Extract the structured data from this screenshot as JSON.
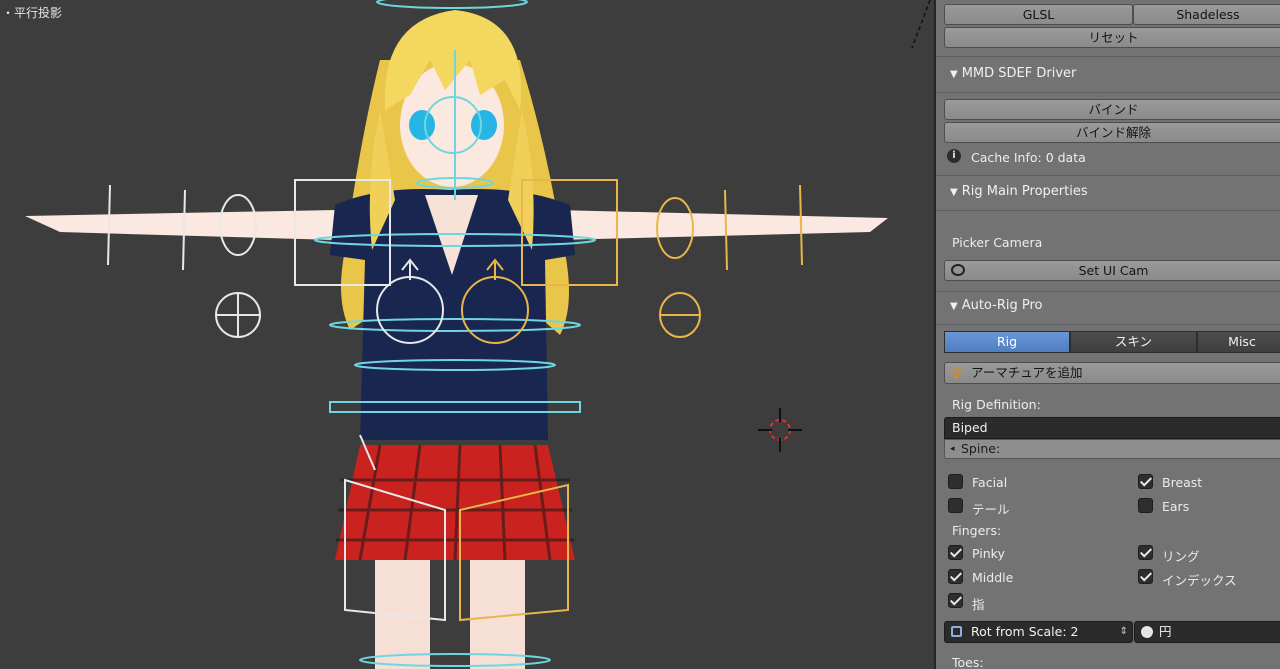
{
  "viewport": {
    "label": "・平行投影"
  },
  "panel": {
    "shading": {
      "glsl_label": "GLSL",
      "shadeless_label": "Shadeless",
      "reset_label": "リセット"
    },
    "mmd_sdef": {
      "title": "MMD SDEF Driver",
      "bind_label": "バインド",
      "unbind_label": "バインド解除",
      "cache_info": "Cache Info: 0 data"
    },
    "rig_main": {
      "title": "Rig Main Properties",
      "picker_camera_label": "Picker Camera",
      "set_ui_cam_label": "Set UI Cam"
    },
    "auto_rig": {
      "title": "Auto-Rig Pro",
      "tabs": [
        {
          "label": "Rig",
          "active": true
        },
        {
          "label": "スキン",
          "active": false
        },
        {
          "label": "Misc",
          "active": false
        }
      ],
      "add_armature_label": "アーマチュアを追加",
      "rig_definition_label": "Rig Definition:",
      "rig_definition_value": "Biped",
      "spine_label": "Spine:",
      "options": [
        {
          "label": "Facial",
          "checked": false
        },
        {
          "label": "Breast",
          "checked": true
        },
        {
          "label": "テール",
          "checked": false
        },
        {
          "label": "Ears",
          "checked": false
        }
      ],
      "fingers_label": "Fingers:",
      "fingers": [
        {
          "label": "Pinky",
          "checked": true
        },
        {
          "label": "リング",
          "checked": true
        },
        {
          "label": "Middle",
          "checked": true
        },
        {
          "label": "インデックス",
          "checked": true
        },
        {
          "label": "指",
          "checked": true
        }
      ],
      "rot_from_scale_label": "Rot from Scale: 2",
      "circle_label": "円",
      "toes_label": "Toes:"
    }
  },
  "colors": {
    "viewport_bg": "#3d3d3d",
    "panel_bg": "#737373",
    "active_tab": "#5a8ad0",
    "bone_cyan": "#6fd6e0",
    "bone_yellow": "#e8b64a",
    "bone_white": "#e8e8e8",
    "skirt_red": "#c8201e",
    "shirt_navy": "#16244a",
    "hair_blonde": "#f2d35a",
    "skin": "#fbe6dc"
  },
  "icons": [
    "info-icon",
    "camera-icon",
    "armature-add-icon",
    "pivot-icon",
    "circle-icon",
    "3d-cursor-icon"
  ]
}
